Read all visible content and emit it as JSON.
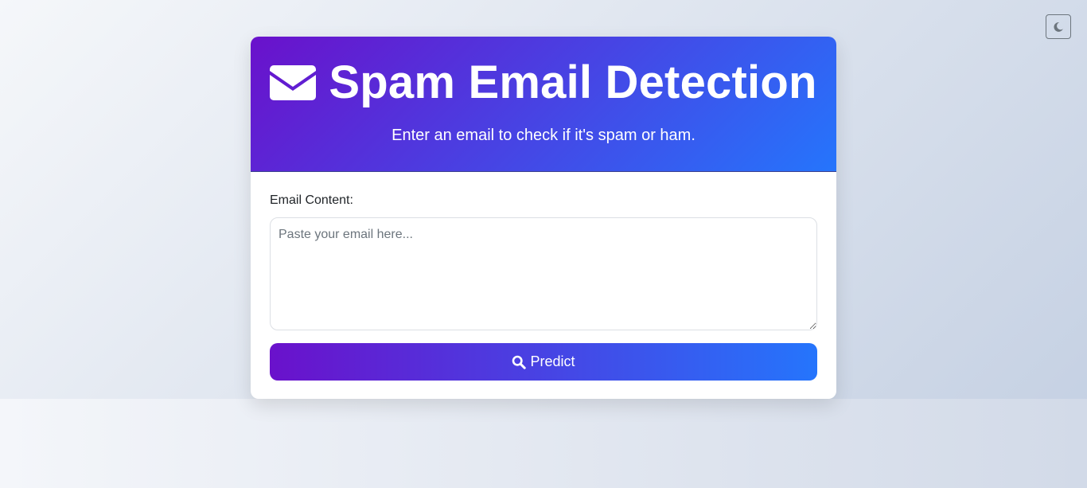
{
  "header": {
    "title": "Spam Email Detection",
    "subtitle": "Enter an email to check if it's spam or ham.",
    "icon": "envelope-icon"
  },
  "form": {
    "label": "Email Content:",
    "placeholder": "Paste your email here...",
    "value": "",
    "predict_label": "Predict",
    "predict_icon": "search-icon"
  },
  "theme_toggle": {
    "icon": "moon-icon"
  },
  "colors": {
    "gradient_start": "#6a11cb",
    "gradient_end": "#2575fc",
    "background_start": "#f5f7fa",
    "background_end": "#c3cfe2"
  }
}
